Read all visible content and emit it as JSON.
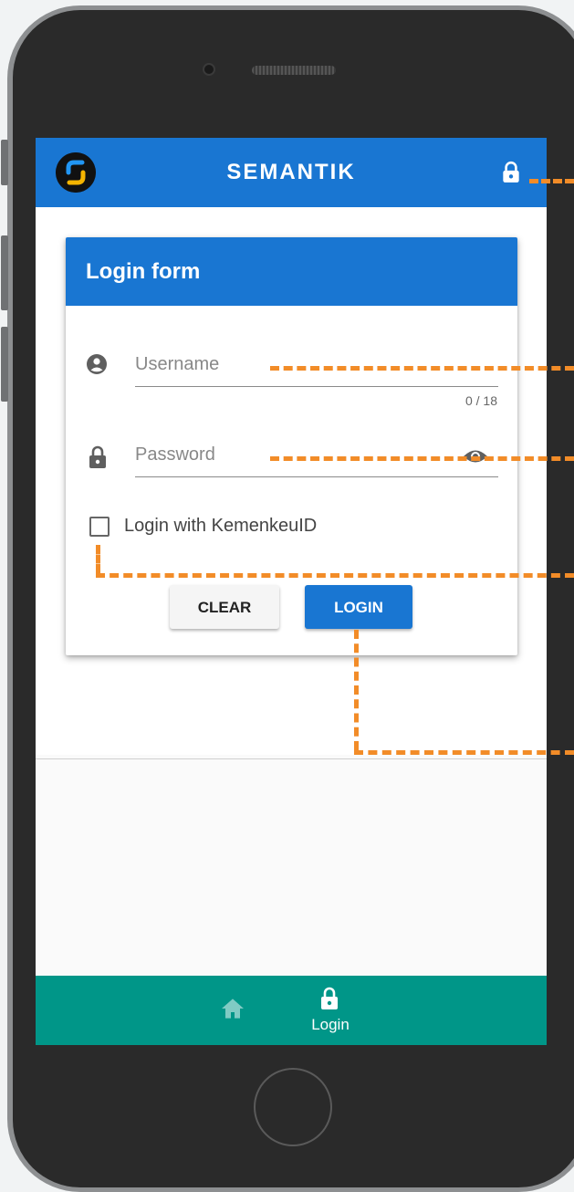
{
  "app": {
    "title": "SEMANTIK"
  },
  "form": {
    "title": "Login form",
    "username": {
      "placeholder": "Username",
      "value": "",
      "counter": "0 / 18"
    },
    "password": {
      "placeholder": "Password",
      "value": ""
    },
    "checkbox_label": "Login with KemenkeuID",
    "checkbox_checked": false,
    "clear_label": "CLEAR",
    "login_label": "LOGIN"
  },
  "bottom_nav": {
    "items": [
      {
        "icon": "home-icon",
        "label": ""
      },
      {
        "icon": "lock-icon",
        "label": "Login"
      }
    ]
  },
  "colors": {
    "primary": "#1976d2",
    "nav": "#009688",
    "annotation": "#f28c28"
  }
}
